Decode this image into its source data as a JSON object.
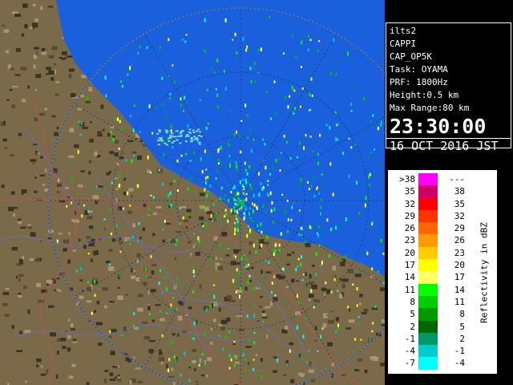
{
  "info": {
    "site": "ilts2",
    "product": "CAPPI",
    "product_code": "CAP_OP5K",
    "task": "Task: OYAMA",
    "prf": "PRF: 1800Hz",
    "height": "Height:0.5 km",
    "max_range": "Max Range:80 km",
    "time": "23:30:00",
    "date": "16 OCT 2016 JST"
  },
  "legend": {
    "title": "Reflectivity in dBZ",
    "rows": [
      {
        "lo": ">38",
        "hi": "---",
        "color": "#ff00ff"
      },
      {
        "lo": "35",
        "hi": "38",
        "color": "#cc0066"
      },
      {
        "lo": "32",
        "hi": "35",
        "color": "#ff0000"
      },
      {
        "lo": "29",
        "hi": "32",
        "color": "#ff3300"
      },
      {
        "lo": "26",
        "hi": "29",
        "color": "#ff6600"
      },
      {
        "lo": "23",
        "hi": "26",
        "color": "#ff9900"
      },
      {
        "lo": "20",
        "hi": "23",
        "color": "#ffcc00"
      },
      {
        "lo": "17",
        "hi": "20",
        "color": "#ffff00"
      },
      {
        "lo": "14",
        "hi": "17",
        "color": "#ffff66"
      },
      {
        "lo": "11",
        "hi": "14",
        "color": "#00ff00"
      },
      {
        "lo": "8",
        "hi": "11",
        "color": "#00cc00"
      },
      {
        "lo": "5",
        "hi": "8",
        "color": "#009900"
      },
      {
        "lo": "2",
        "hi": "5",
        "color": "#006600"
      },
      {
        "lo": "-1",
        "hi": "2",
        "color": "#009966"
      },
      {
        "lo": "-4",
        "hi": "-1",
        "color": "#00cccc"
      },
      {
        "lo": "-7",
        "hi": "-4",
        "color": "#00ffff"
      }
    ]
  }
}
